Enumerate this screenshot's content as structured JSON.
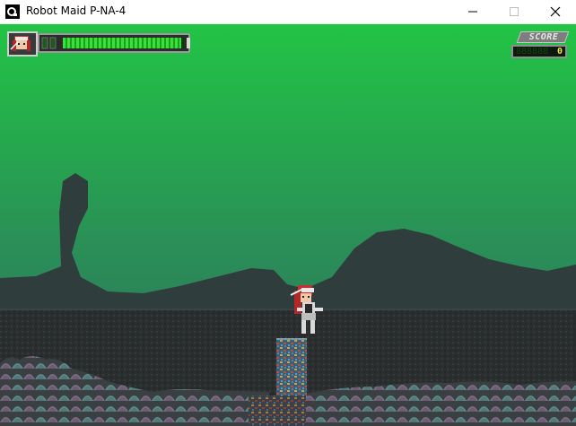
{
  "window": {
    "title": "Robot Maid P-NA-4",
    "controls": {
      "minimize": "minimize",
      "maximize": "maximize",
      "close": "close"
    }
  },
  "hud": {
    "health_fraction": 0.97,
    "score_label": "SCORE",
    "score_value": "0",
    "score_ghost_digits": "888888"
  },
  "palette": {
    "sky_top": "#22c445",
    "sky_bottom": "#2f6f5e",
    "mountains": "#2f3d3d",
    "ground": "#2b2e2f"
  }
}
